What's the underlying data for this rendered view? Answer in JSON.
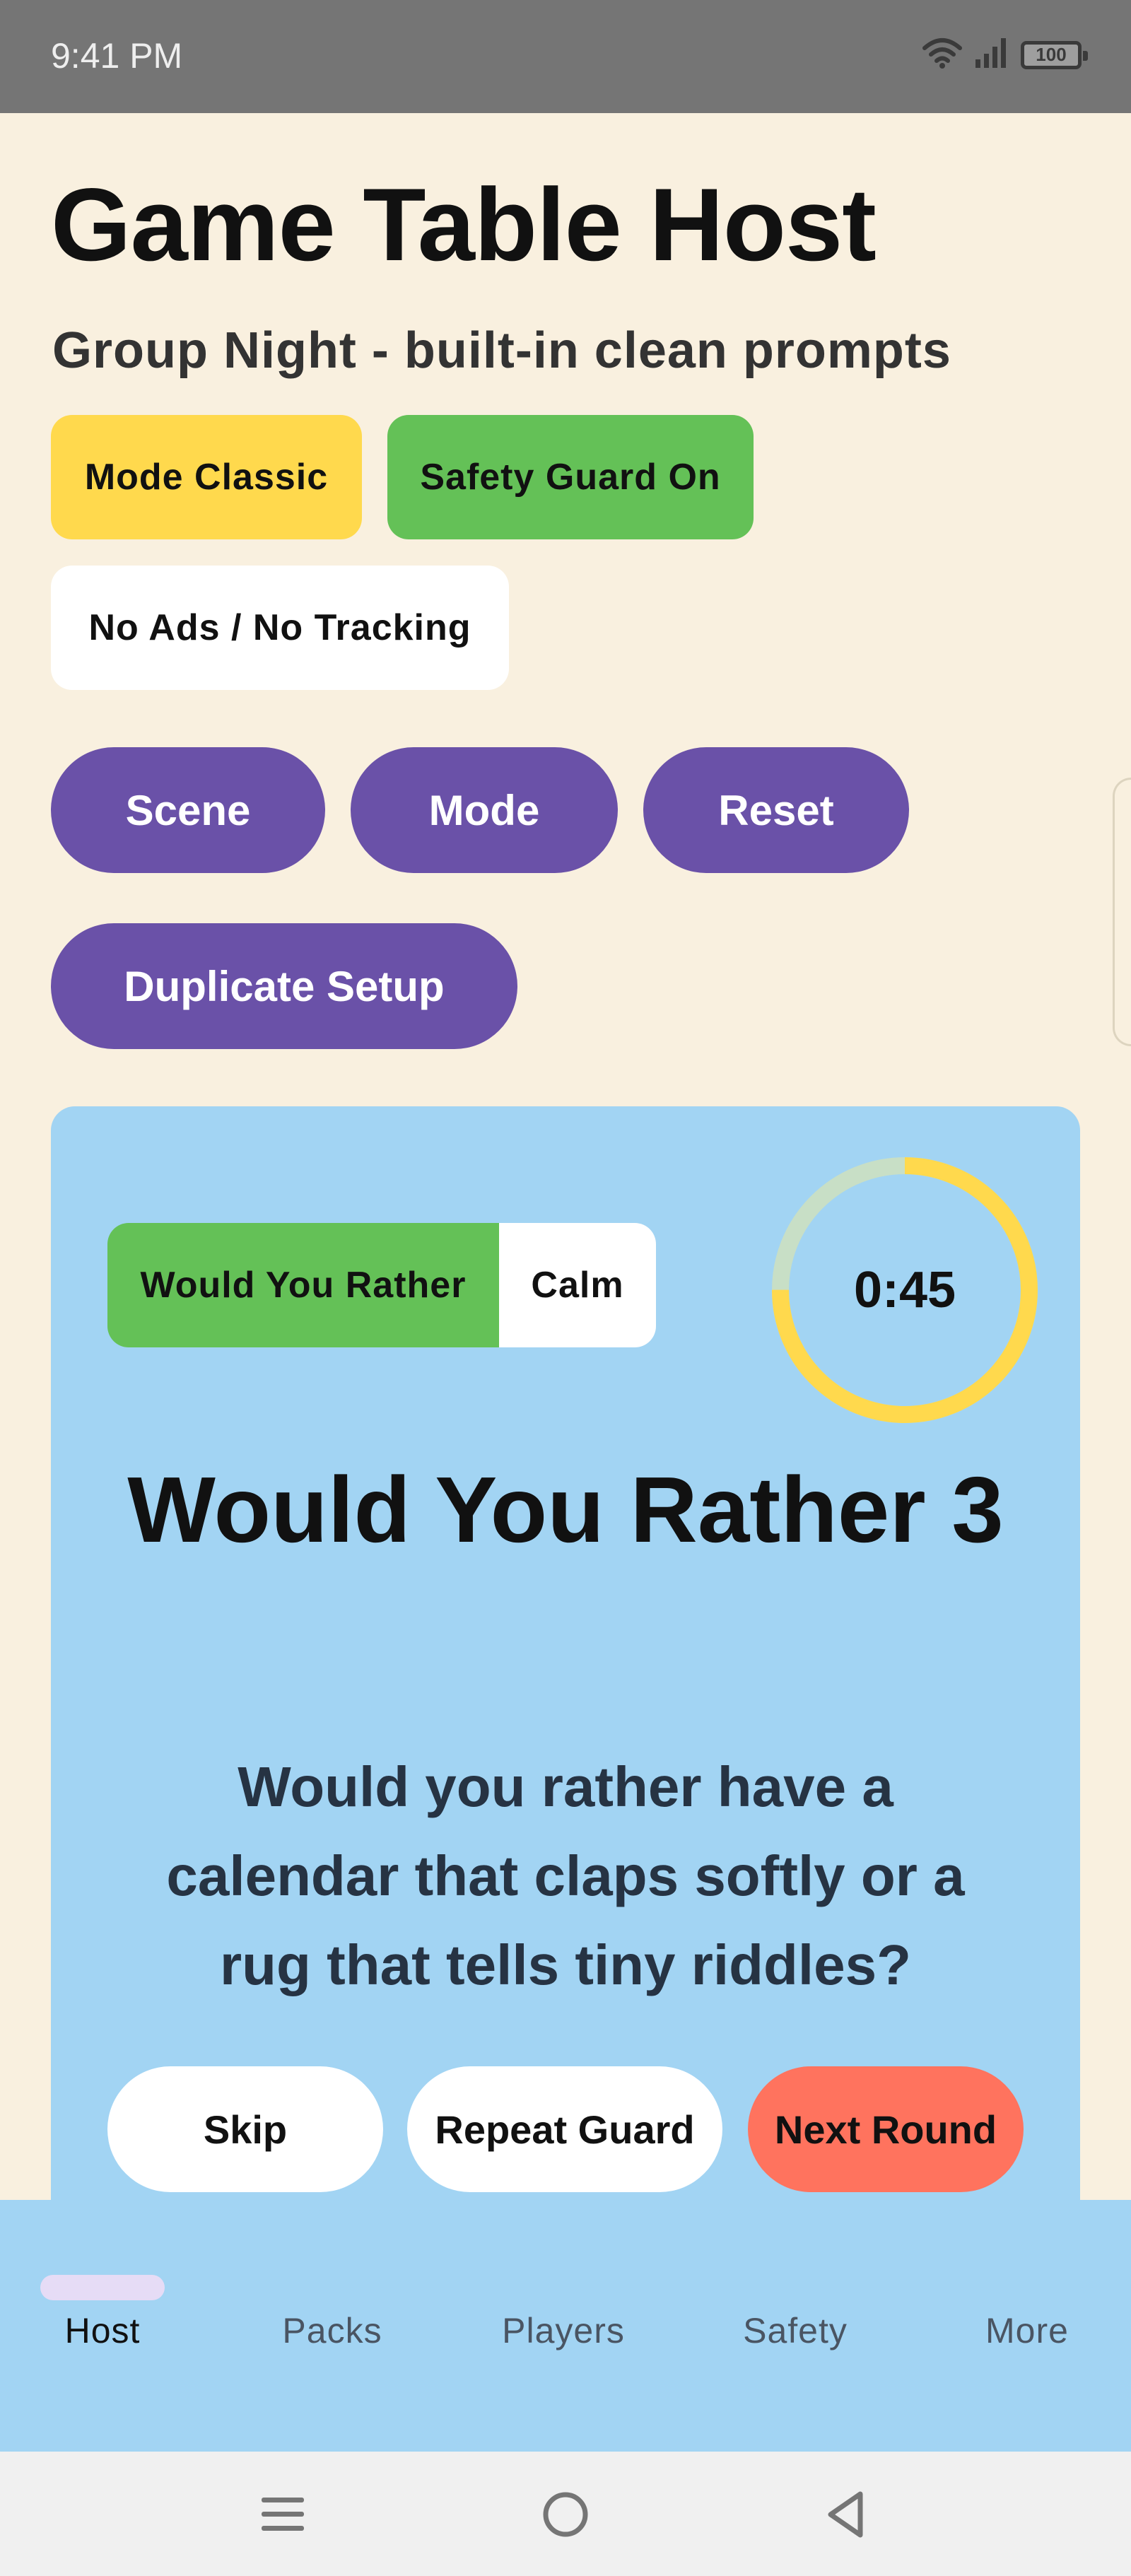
{
  "status_bar": {
    "time": "9:41 PM",
    "battery": "100",
    "icons": [
      "wifi-icon",
      "signal-icon",
      "battery-icon"
    ]
  },
  "header": {
    "title": "Game Table Host",
    "subtitle": "Group Night - built-in clean prompts"
  },
  "chips": {
    "mode": "Mode Classic",
    "safety": "Safety Guard On",
    "privacy": "No Ads / No Tracking"
  },
  "actions": {
    "scene": "Scene",
    "mode": "Mode",
    "reset": "Reset",
    "duplicate": "Duplicate Setup"
  },
  "card": {
    "category": "Would You Rather",
    "mood": "Calm",
    "timer": {
      "label": "0:45",
      "remaining_fraction": 0.75,
      "ring_color": "#ffd94d",
      "track_color": "#c8dfc6"
    },
    "title": "Would You Rather 3",
    "prompt": "Would you rather have a calendar that claps softly or a rug that tells tiny riddles?",
    "buttons": {
      "skip": "Skip",
      "repeat": "Repeat Guard",
      "next": "Next Round"
    }
  },
  "bottom_nav": {
    "active": "Host",
    "items": [
      {
        "label": "Host"
      },
      {
        "label": "Packs"
      },
      {
        "label": "Players"
      },
      {
        "label": "Safety"
      },
      {
        "label": "More"
      }
    ]
  },
  "colors": {
    "background": "#f9f0df",
    "accent_purple": "#6a51a8",
    "card_blue": "#a2d4f3",
    "mode_yellow": "#ffd94d",
    "safety_green": "#64c157",
    "next_coral": "#ff735e"
  }
}
